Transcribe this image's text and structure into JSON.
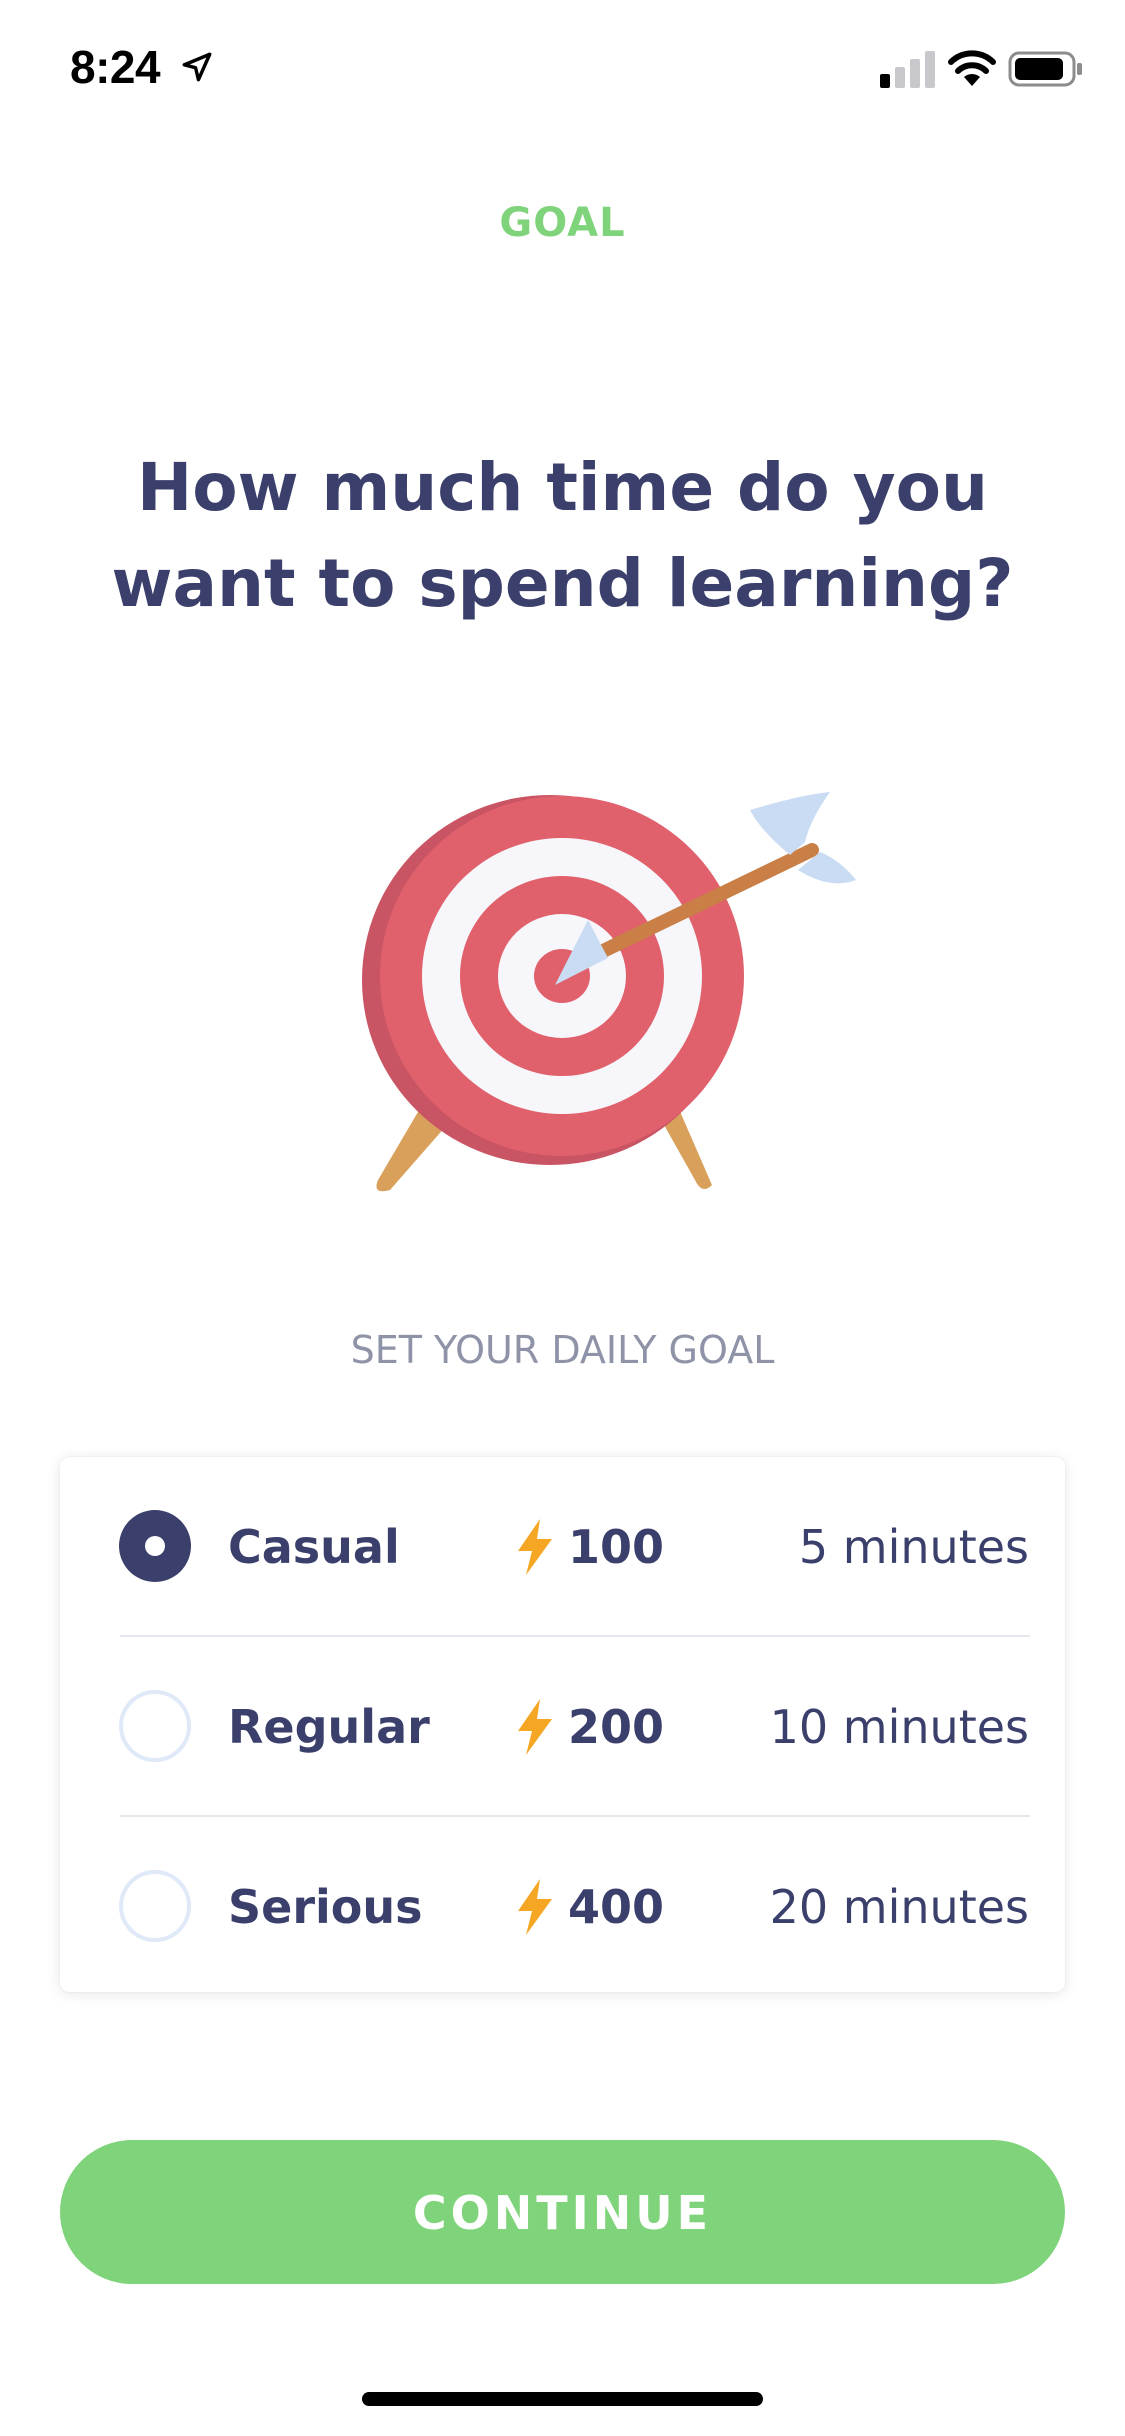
{
  "status_bar": {
    "time": "8:24",
    "icons": [
      "location-arrow-icon",
      "cellular-signal-icon",
      "wifi-icon",
      "battery-icon"
    ]
  },
  "header": {
    "step_label": "GOAL"
  },
  "question": {
    "title": "How much time do you want to spend learning?"
  },
  "illustration": {
    "icon": "target-with-arrow-illustration"
  },
  "daily_goal": {
    "section_label": "SET YOUR DAILY GOAL",
    "options": [
      {
        "name": "Casual",
        "xp": "100",
        "time": "5 minutes",
        "selected": true
      },
      {
        "name": "Regular",
        "xp": "200",
        "time": "10 minutes",
        "selected": false
      },
      {
        "name": "Serious",
        "xp": "400",
        "time": "20 minutes",
        "selected": false
      }
    ]
  },
  "actions": {
    "continue_label": "CONTINUE"
  },
  "colors": {
    "accent_green": "#7fd37a",
    "text_navy": "#3b3f6b",
    "muted_gray": "#8f93a8",
    "bolt_orange": "#f5a623",
    "target_red": "#e0616c"
  }
}
